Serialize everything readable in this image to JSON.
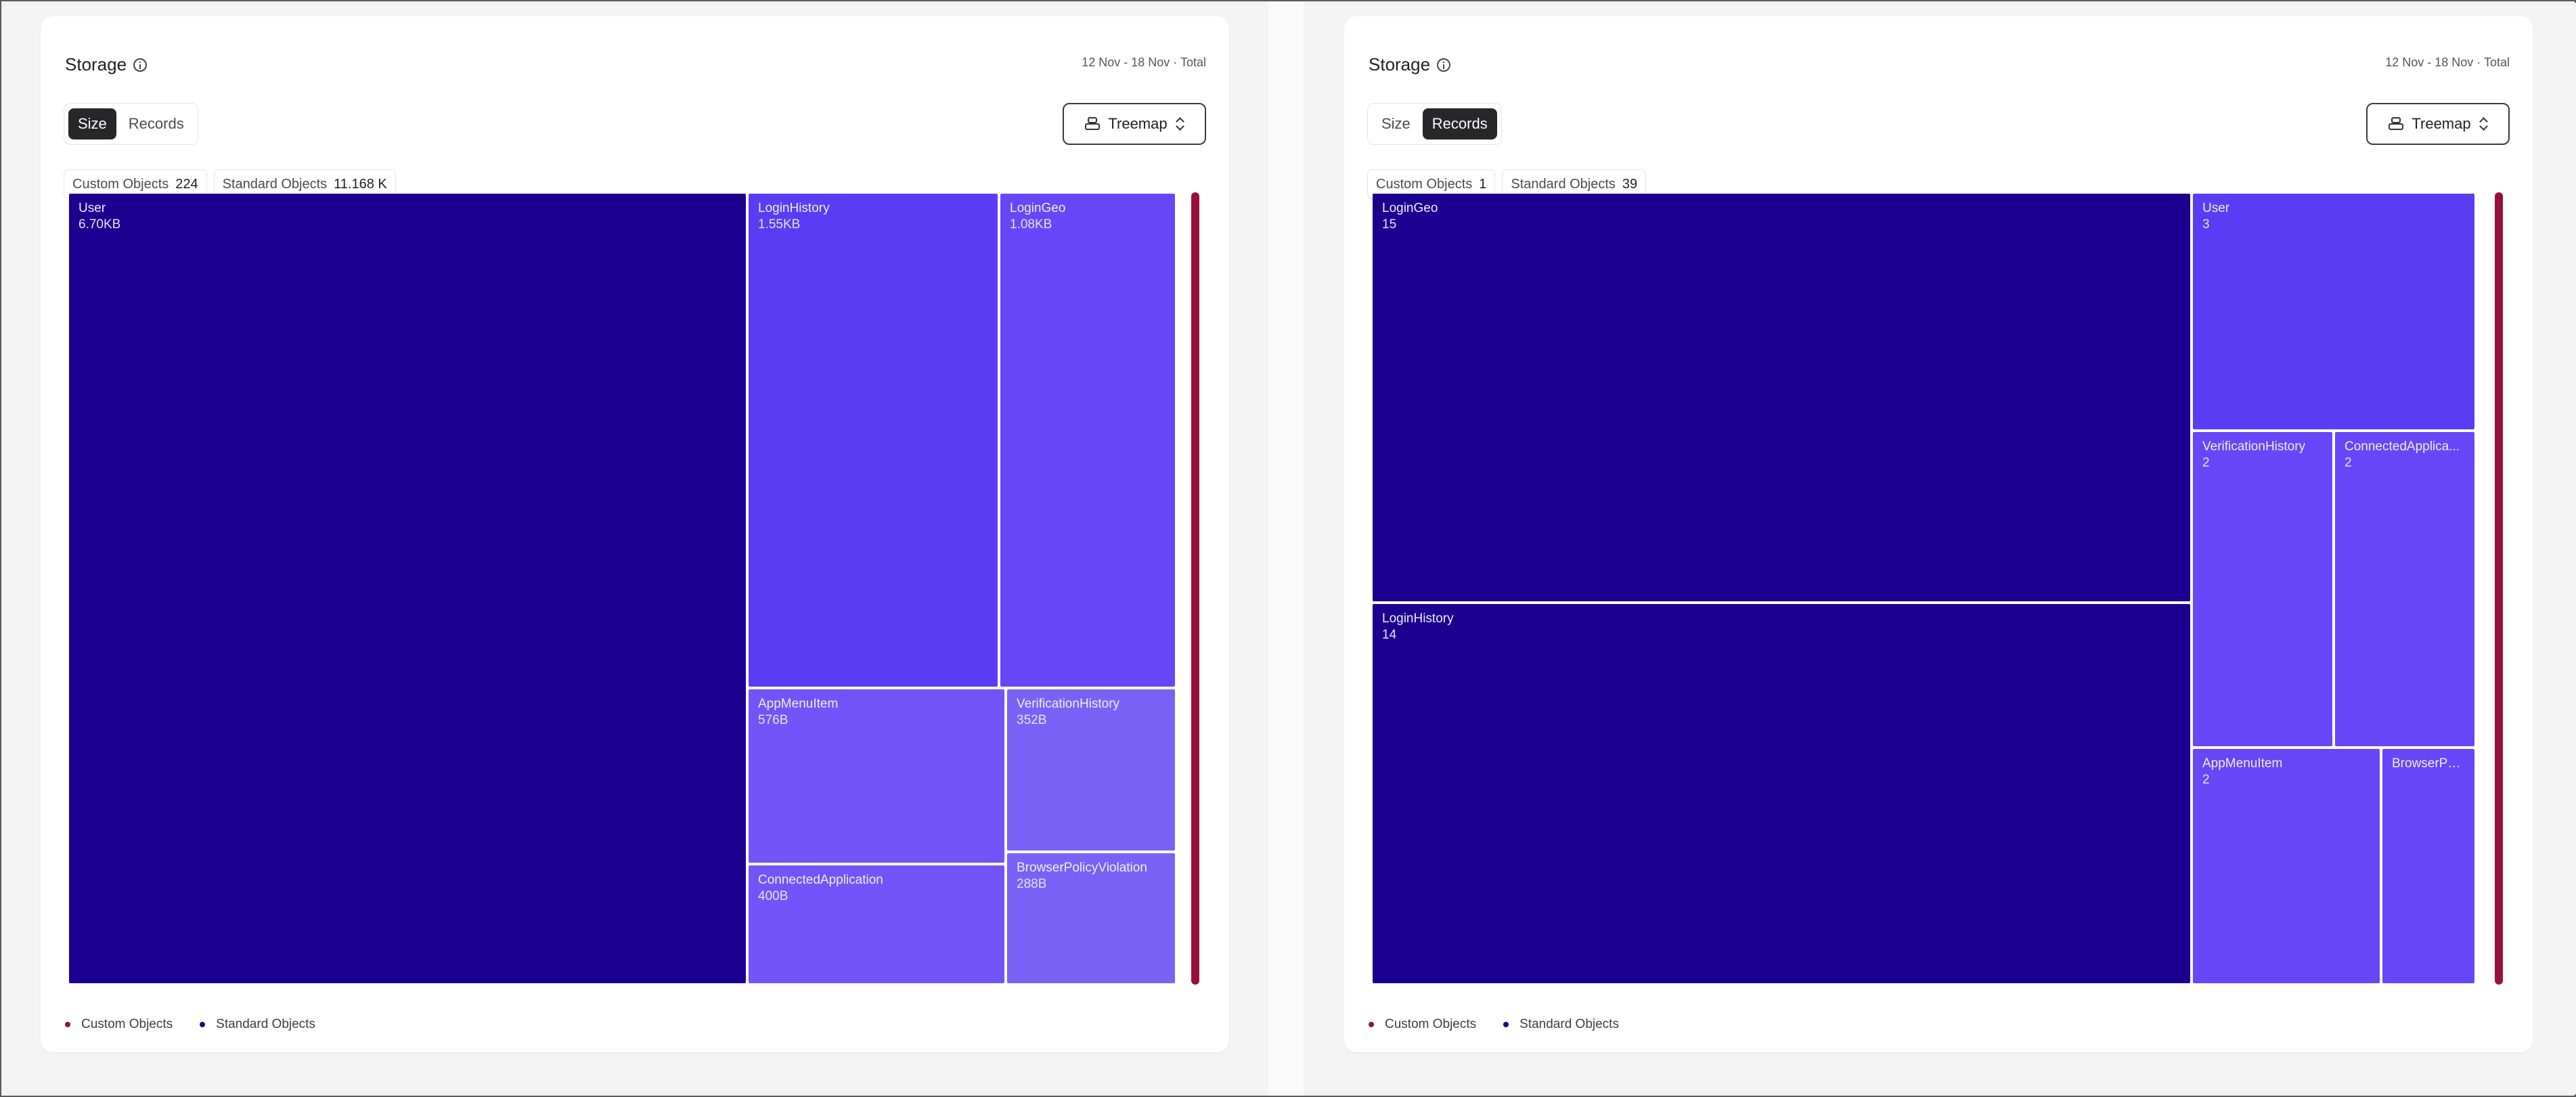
{
  "colors": {
    "custom": "#9a0f3a",
    "standard": "#1c0080",
    "shade1": "#1c0090",
    "shade2": "#5a3cf5",
    "shade3": "#6547f7",
    "shade4": "#7154f7",
    "shade5": "#7a61f6"
  },
  "panels": [
    {
      "title": "Storage",
      "date_range": "12 Nov - 18 Nov · Total",
      "toggle": {
        "options": [
          "Size",
          "Records"
        ],
        "active": "Size"
      },
      "chart_type_select": "Treemap",
      "chips": [
        {
          "label": "Custom Objects",
          "value": "224"
        },
        {
          "label": "Standard Objects",
          "value": "11.168 K"
        }
      ],
      "legend": [
        "Custom Objects",
        "Standard Objects"
      ],
      "chart_data": {
        "type": "treemap",
        "metric": "Size",
        "series": [
          {
            "name": "Standard Objects",
            "items": [
              {
                "name": "User",
                "label": "6.70KB",
                "value": 6700
              },
              {
                "name": "LoginHistory",
                "label": "1.55KB",
                "value": 1550
              },
              {
                "name": "LoginGeo",
                "label": "1.08KB",
                "value": 1080
              },
              {
                "name": "AppMenuItem",
                "label": "576B",
                "value": 576
              },
              {
                "name": "ConnectedApplication",
                "label": "400B",
                "value": 400
              },
              {
                "name": "VerificationHistory",
                "label": "352B",
                "value": 352
              },
              {
                "name": "BrowserPolicyViolation",
                "label": "288B",
                "value": 288
              }
            ]
          },
          {
            "name": "Custom Objects",
            "items": [
              {
                "name": "Custom Objects",
                "label": "224",
                "value": 224
              }
            ]
          }
        ]
      }
    },
    {
      "title": "Storage",
      "date_range": "12 Nov - 18 Nov · Total",
      "toggle": {
        "options": [
          "Size",
          "Records"
        ],
        "active": "Records"
      },
      "chart_type_select": "Treemap",
      "chips": [
        {
          "label": "Custom Objects",
          "value": "1"
        },
        {
          "label": "Standard Objects",
          "value": "39"
        }
      ],
      "legend": [
        "Custom Objects",
        "Standard Objects"
      ],
      "chart_data": {
        "type": "treemap",
        "metric": "Records",
        "series": [
          {
            "name": "Standard Objects",
            "items": [
              {
                "name": "LoginGeo",
                "label": "15",
                "value": 15
              },
              {
                "name": "LoginHistory",
                "label": "14",
                "value": 14
              },
              {
                "name": "User",
                "label": "3",
                "value": 3
              },
              {
                "name": "VerificationHistory",
                "label": "2",
                "value": 2
              },
              {
                "name": "ConnectedApplica...",
                "label": "2",
                "value": 2
              },
              {
                "name": "AppMenuItem",
                "label": "2",
                "value": 2
              },
              {
                "name": "BrowserPo...",
                "label": "",
                "value": 1
              }
            ]
          },
          {
            "name": "Custom Objects",
            "items": [
              {
                "name": "Custom Objects",
                "label": "1",
                "value": 1
              }
            ]
          }
        ]
      }
    }
  ]
}
